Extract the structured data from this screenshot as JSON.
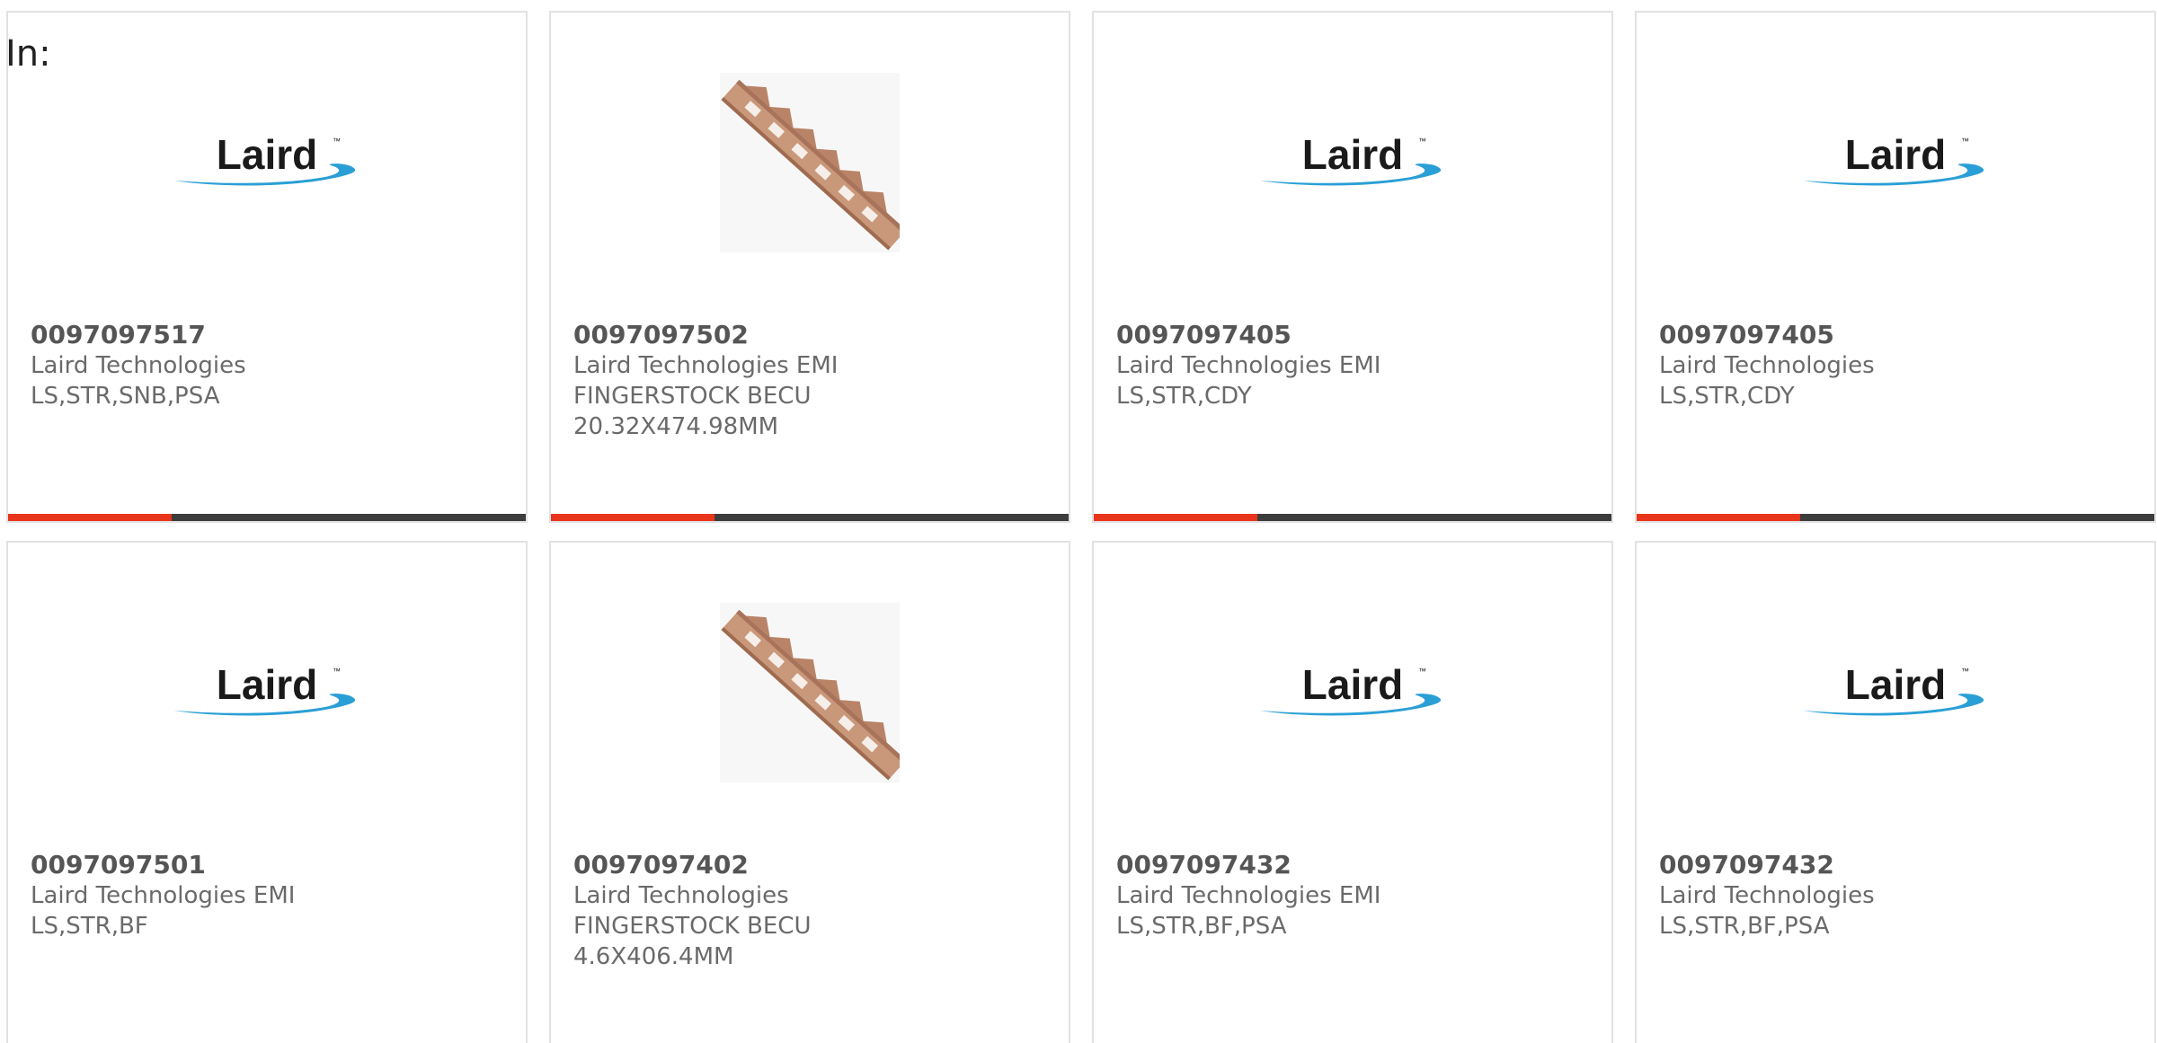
{
  "filter": {
    "label": "In:"
  },
  "colors": {
    "accent": "#e8351b",
    "bar": "#3d3d3d",
    "border": "#e2e2e2",
    "text": "#6a6a6a",
    "brand_blue": "#2a9fd6"
  },
  "products": [
    {
      "part": "0097097517",
      "brand": "Laird Technologies",
      "desc": "LS,STR,SNB,PSA",
      "image": "laird-logo"
    },
    {
      "part": "0097097502",
      "brand": "Laird Technologies EMI",
      "desc": "FINGERSTOCK BECU\n20.32X474.98MM",
      "image": "fingerstock-photo"
    },
    {
      "part": "0097097405",
      "brand": "Laird Technologies EMI",
      "desc": "LS,STR,CDY",
      "image": "laird-logo"
    },
    {
      "part": "0097097405",
      "brand": "Laird Technologies",
      "desc": "LS,STR,CDY",
      "image": "laird-logo"
    },
    {
      "part": "0097097501",
      "brand": "Laird Technologies EMI",
      "desc": "LS,STR,BF",
      "image": "laird-logo"
    },
    {
      "part": "0097097402",
      "brand": "Laird Technologies",
      "desc": "FINGERSTOCK BECU\n4.6X406.4MM",
      "image": "fingerstock-photo"
    },
    {
      "part": "0097097432",
      "brand": "Laird Technologies EMI",
      "desc": "LS,STR,BF,PSA",
      "image": "laird-logo"
    },
    {
      "part": "0097097432",
      "brand": "Laird Technologies",
      "desc": "LS,STR,BF,PSA",
      "image": "laird-logo"
    }
  ],
  "logo_text": "Laird"
}
